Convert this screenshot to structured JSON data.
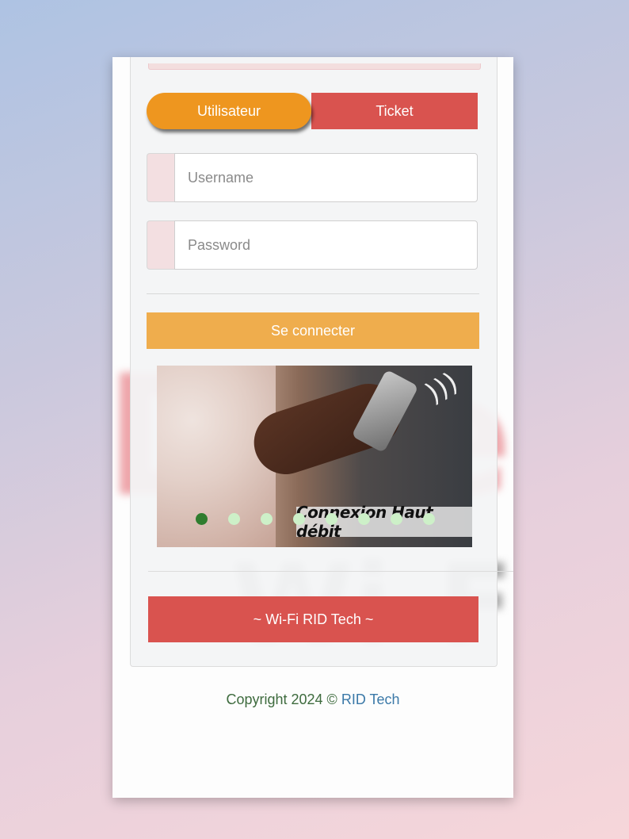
{
  "login": {
    "tabs": {
      "user_label": "Utilisateur",
      "ticket_label": "Ticket"
    },
    "username_placeholder": "Username",
    "password_placeholder": "Password",
    "submit_label": "Se connecter"
  },
  "banner": {
    "caption": "Connexion Haut débit",
    "slide_count": 8,
    "active_slide": 1
  },
  "footer": {
    "wifi_button_label": "~ Wi-Fi RID Tech ~",
    "copyright_prefix": "Copyright 2024 ©",
    "copyright_link": "RID Tech"
  },
  "colors": {
    "accent_orange": "#ee961f",
    "login_orange": "#efad4d",
    "danger_red": "#d9534f",
    "dot_active": "#2f7d2f",
    "dot_inactive": "#cdf0c8"
  },
  "icons": {
    "banner_signal": "wifi-signal-icon"
  }
}
